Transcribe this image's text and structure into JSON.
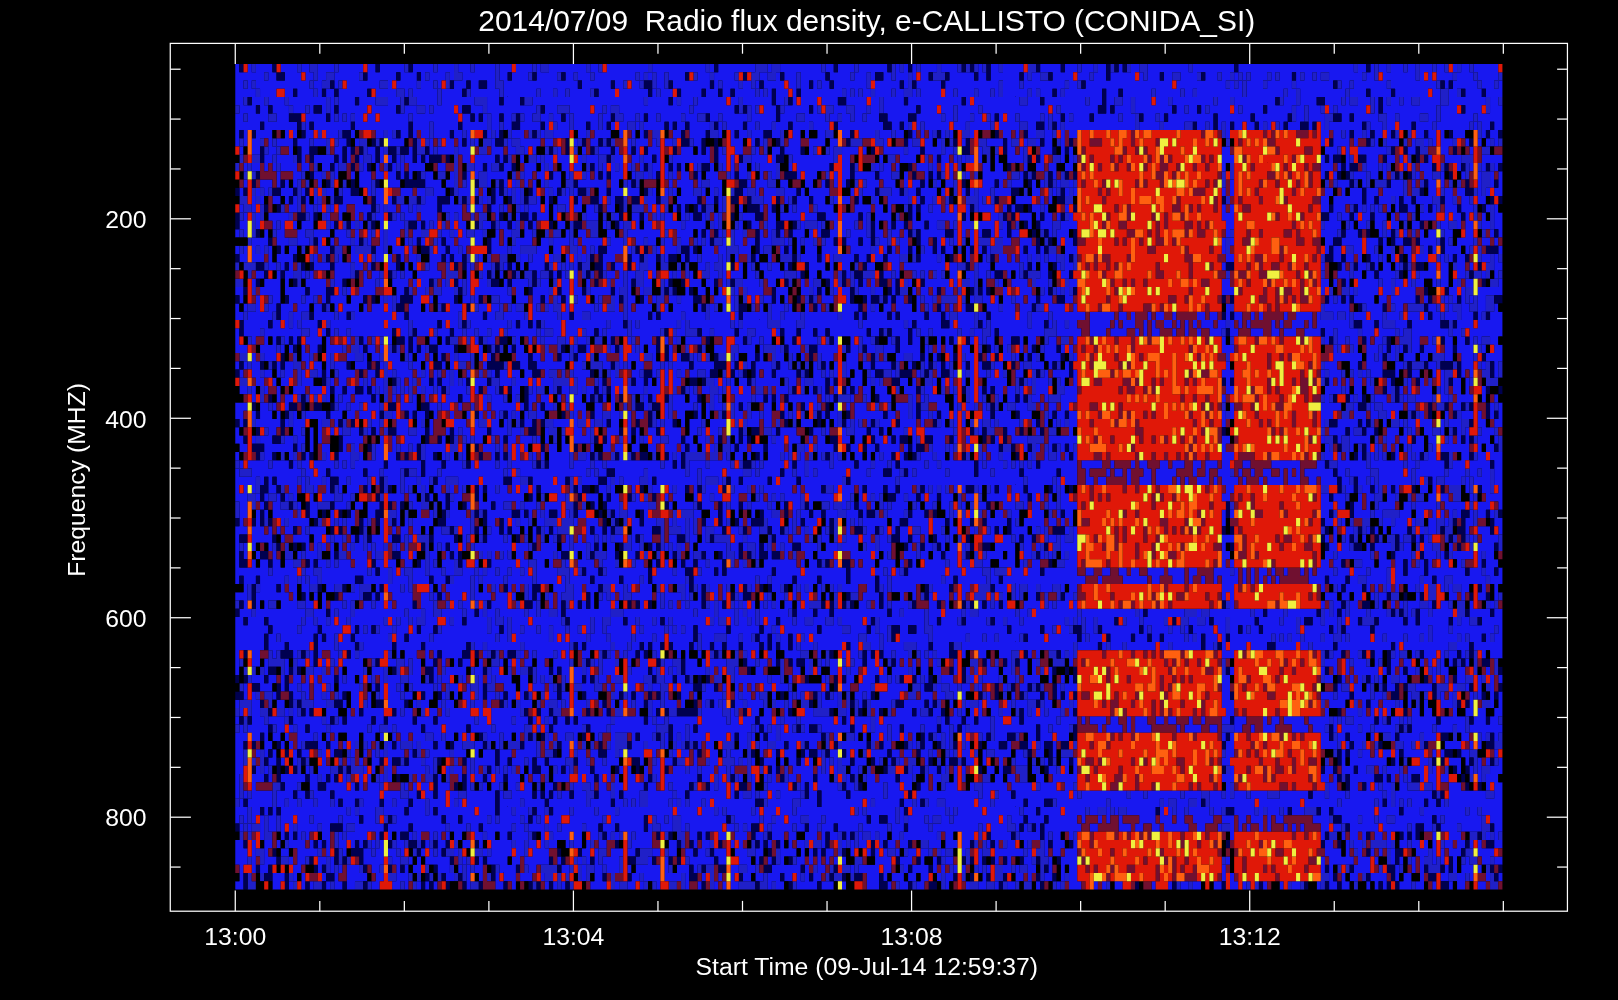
{
  "title": "2014/07/09  Radio flux density, e-CALLISTO (CONIDA_SI)",
  "plot": {
    "xlabel": "Start Time (09-Jul-14 12:59:37)",
    "ylabel": "Frequency (MHZ)",
    "xticks": [
      "13:00",
      "13:04",
      "13:08",
      "13:12"
    ],
    "yticks": [
      "200",
      "400",
      "600",
      "800"
    ]
  }
}
